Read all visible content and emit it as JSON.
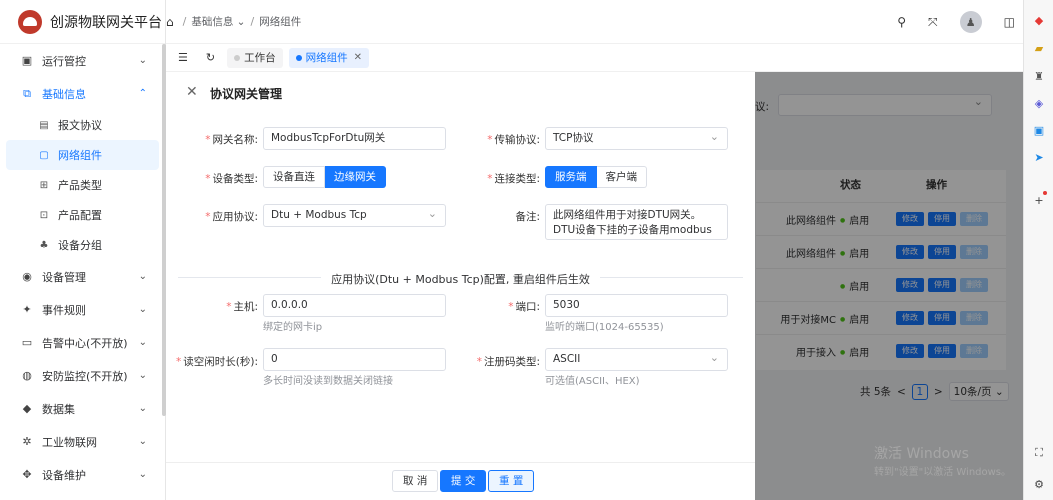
{
  "app": {
    "title": "创源物联网关平台"
  },
  "topbar": {
    "breadcrumb": [
      "基础信息 ⌄",
      "网络组件"
    ],
    "actions": [
      "search-icon",
      "fullscreen-icon",
      "avatar",
      "layout-icon"
    ]
  },
  "sidebar": {
    "items": [
      {
        "label": "运行管控",
        "icon": "monitor-icon",
        "caret": "⌄"
      },
      {
        "label": "基础信息",
        "icon": "base-icon",
        "caret": "⌃"
      },
      {
        "label": "设备管理",
        "icon": "device-icon",
        "caret": "⌄"
      },
      {
        "label": "事件规则",
        "icon": "rule-icon",
        "caret": "⌄"
      },
      {
        "label": "告警中心(不开放)",
        "icon": "alarm-icon",
        "caret": "⌄"
      },
      {
        "label": "安防监控(不开放)",
        "icon": "security-icon",
        "caret": "⌄"
      },
      {
        "label": "数据集",
        "icon": "dataset-icon",
        "caret": "⌄"
      },
      {
        "label": "工业物联网",
        "icon": "iot-icon",
        "caret": "⌄"
      },
      {
        "label": "设备维护",
        "icon": "maintain-icon",
        "caret": "⌄"
      }
    ],
    "sub_items": [
      {
        "label": "报文协议",
        "icon": "doc-icon"
      },
      {
        "label": "网络组件",
        "icon": "network-icon"
      },
      {
        "label": "产品类型",
        "icon": "grid-icon"
      },
      {
        "label": "产品配置",
        "icon": "config-icon"
      },
      {
        "label": "设备分组",
        "icon": "group-icon"
      }
    ]
  },
  "tabs": [
    {
      "label": "工作台",
      "active": false
    },
    {
      "label": "网络组件",
      "active": true
    }
  ],
  "background_page": {
    "proto_label": "议:",
    "table_headers": [
      "状态",
      "操作"
    ],
    "rows": [
      {
        "desc": "此网络组件",
        "status": "启用"
      },
      {
        "desc": "此网络组件",
        "status": "启用"
      },
      {
        "desc": "",
        "status": "启用"
      },
      {
        "desc": "用于对接MC",
        "status": "启用"
      },
      {
        "desc": "用于接入",
        "status": "启用"
      }
    ],
    "row_buttons": [
      "修改",
      "停用",
      "删除"
    ],
    "pager": {
      "total": "共 5条",
      "page": "1",
      "size": "10条/页 ⌄",
      "prev": "<",
      "next": ">"
    }
  },
  "dialog": {
    "title": "协议网关管理",
    "gateway_name_label": "网关名称:",
    "gateway_name_value": "ModbusTcpForDtu网关",
    "transport_label": "传输协议:",
    "transport_value": "TCP协议",
    "device_type_label": "设备类型:",
    "device_type_options": [
      "设备直连",
      "边缘网关"
    ],
    "device_type_selected": "边缘网关",
    "connect_type_label": "连接类型:",
    "connect_type_options": [
      "服务端",
      "客户端"
    ],
    "connect_type_selected": "服务端",
    "app_protocol_label": "应用协议:",
    "app_protocol_value": "Dtu + Modbus Tcp",
    "remark_label": "备注:",
    "remark_value": "此网络组件用于对接DTU网关。DTU设备下挂的子设备用modbus tcp协议通讯",
    "section_title": "应用协议(Dtu + Modbus Tcp)配置, 重启组件后生效",
    "host_label": "主机:",
    "host_value": "0.0.0.0",
    "host_hint": "绑定的网卡ip",
    "port_label": "端口:",
    "port_value": "5030",
    "port_hint": "监听的端口(1024-65535)",
    "idle_label": "读空闲时长(秒):",
    "idle_value": "0",
    "idle_hint": "多长时间没读到数据关闭链接",
    "register_label": "注册码类型:",
    "register_value": "ASCII",
    "register_hint": "可选值(ASCII、HEX)",
    "buttons": {
      "cancel": "取 消",
      "submit": "提 交",
      "reset": "重 置"
    }
  },
  "watermark": {
    "line1": "激活 Windows",
    "line2": "转到\"设置\"以激活 Windows。"
  },
  "colors": {
    "primary": "#1677ff",
    "required": "#f56c6c",
    "success": "#52c41a"
  }
}
